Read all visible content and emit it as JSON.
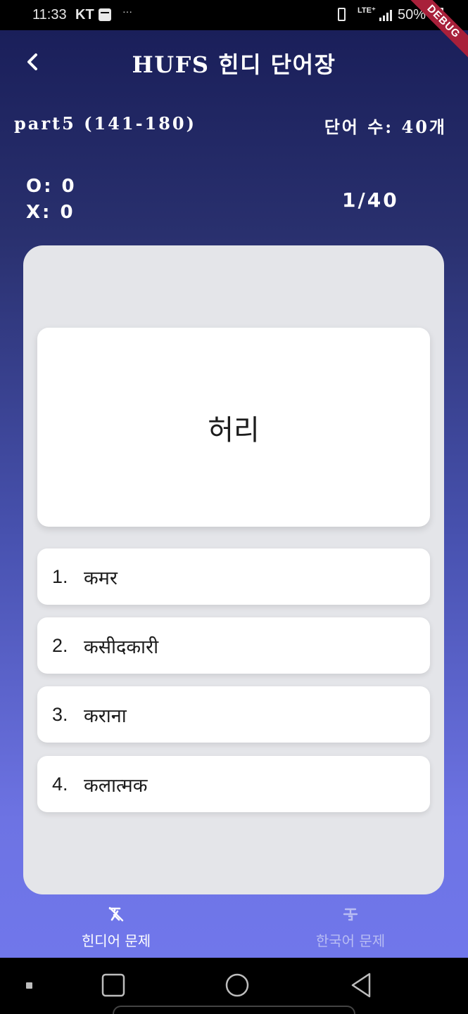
{
  "status_bar": {
    "time": "11:33",
    "carrier": "KT",
    "dots": "···",
    "network": "LTE⁺",
    "battery": "50%"
  },
  "debug_banner": "DEBUG",
  "header": {
    "title": "HUFS 힌디 단어장"
  },
  "info": {
    "part": "part5 (141-180)",
    "word_count": "단어 수: 40개"
  },
  "score": {
    "correct": "O: 0",
    "wrong": "X: 0",
    "progress": "1/40"
  },
  "question": {
    "word": "허리"
  },
  "options": [
    {
      "num": "1.",
      "text": "कमर"
    },
    {
      "num": "2.",
      "text": "कसीदकारी"
    },
    {
      "num": "3.",
      "text": "कराना"
    },
    {
      "num": "4.",
      "text": "कलात्मक"
    }
  ],
  "bottom_nav": {
    "hindi_label": "힌디어 문제",
    "korean_label": "한국어 문제"
  },
  "colors": {
    "selected_nav": "#ffffff",
    "unselected_nav": "#b9bdf3",
    "panel": "#e4e5e9"
  }
}
